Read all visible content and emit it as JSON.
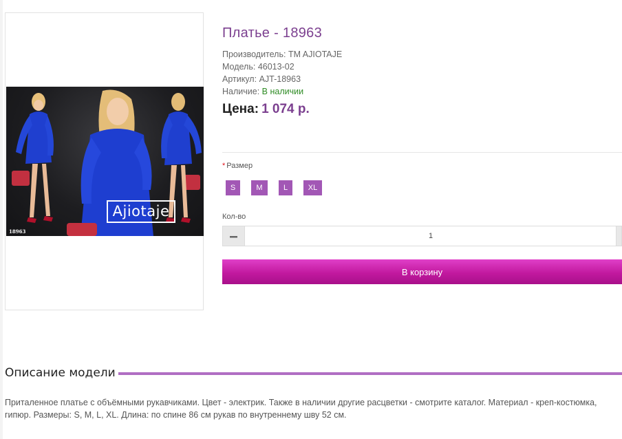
{
  "product": {
    "title": "Платье - 18963",
    "manufacturer_label": "Производитель:",
    "manufacturer": "TM AJIOTAJE",
    "model_label": "Модель:",
    "model": "46013-02",
    "sku_label": "Артикул:",
    "sku": "AJT-18963",
    "availability_label": "Наличие:",
    "availability": "В наличии",
    "price_label": "Цена:",
    "price": "1 074 р.",
    "image": {
      "brand_logo": "Ajiotaje",
      "code": "18963",
      "dress_color": "#1f3fcf"
    }
  },
  "options": {
    "size_required_mark": "*",
    "size_label": "Размер",
    "sizes": [
      "S",
      "M",
      "L",
      "XL"
    ],
    "accent_color": "#a257b5"
  },
  "quantity": {
    "label": "Кол-во",
    "value": "1",
    "minus_icon": "minus-icon"
  },
  "cart_button": {
    "label": "В корзину",
    "color": "#c2199f"
  },
  "description": {
    "heading": "Описание модели",
    "text": "Приталенное платье с объёмными рукавчиками. Цвет - электрик. Также в наличии другие расцветки - смотрите каталог. Материал - креп-костюмка, гипюр. Размеры: S, M, L, XL. Длина: по спине 86 см рукав по внутреннему шву 52 см."
  }
}
